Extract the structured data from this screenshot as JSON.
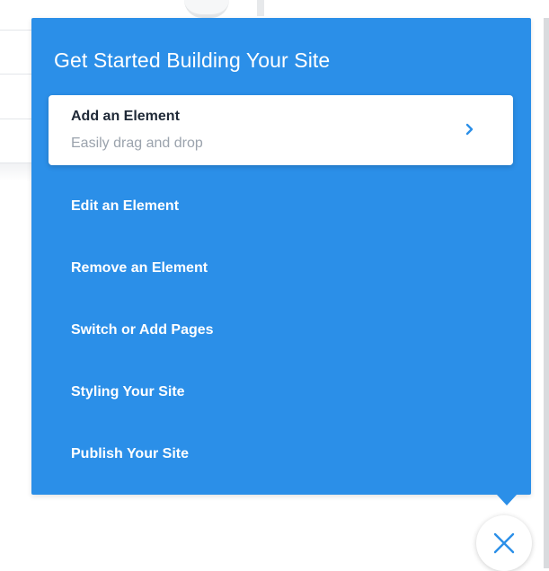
{
  "panel": {
    "title": "Get Started Building Your Site",
    "accent_color": "#2b8fe8"
  },
  "active_card": {
    "title": "Add an Element",
    "subtitle": "Easily drag and drop",
    "icon": "chevron-right-icon"
  },
  "menu": {
    "items": [
      {
        "label": "Edit an Element"
      },
      {
        "label": "Remove an Element"
      },
      {
        "label": "Switch or Add Pages"
      },
      {
        "label": "Styling Your Site"
      },
      {
        "label": "Publish Your Site"
      }
    ]
  },
  "close_button": {
    "icon": "close-icon"
  }
}
